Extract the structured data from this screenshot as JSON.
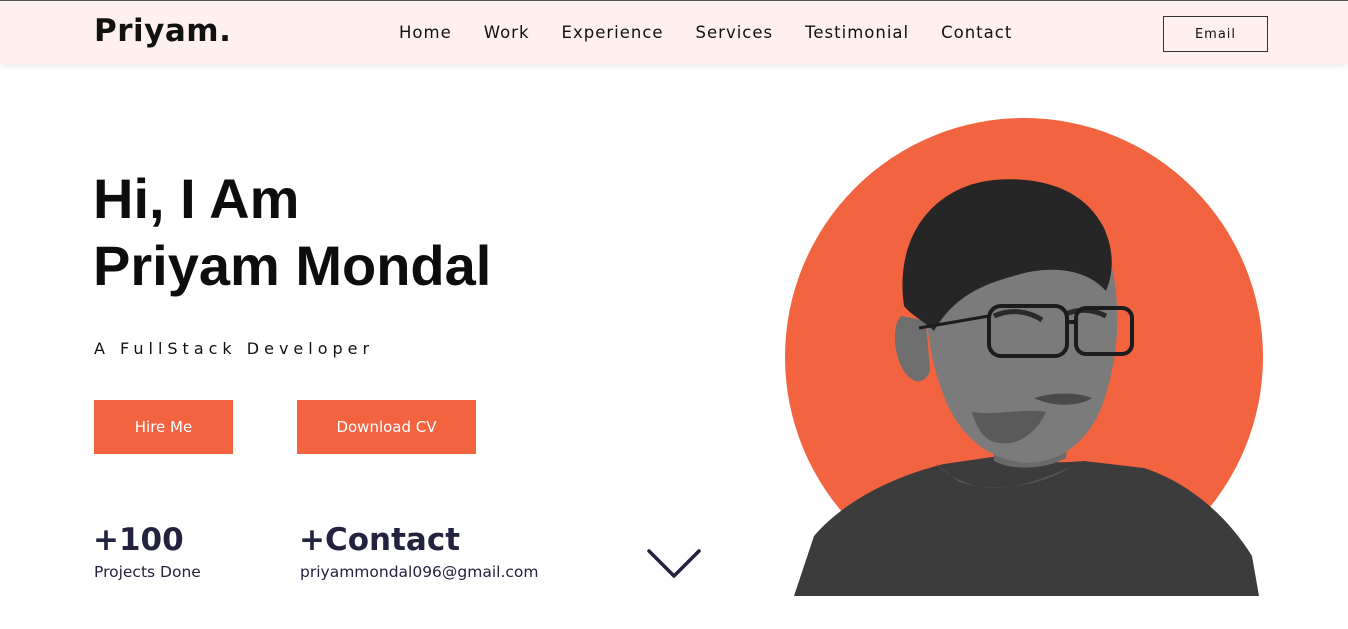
{
  "nav": {
    "logo": "Priyam.",
    "links": [
      "Home",
      "Work",
      "Experience",
      "Services",
      "Testimonial",
      "Contact"
    ],
    "email_button": "Email"
  },
  "hero": {
    "greeting": "Hi, I Am",
    "name": "Priyam Mondal",
    "tagline": "A FullStack Developer",
    "hire_button": "Hire Me",
    "cv_button": "Download CV"
  },
  "stats": {
    "projects_value": "+100",
    "projects_label": "Projects Done",
    "contact_title": "+Contact",
    "contact_email": "priyammondal096@gmail.com"
  },
  "colors": {
    "accent": "#f26440",
    "nav_bg": "#fdf0ef",
    "stat_text": "#23233f"
  },
  "icons": {
    "scroll_down": "chevron-down-icon"
  }
}
